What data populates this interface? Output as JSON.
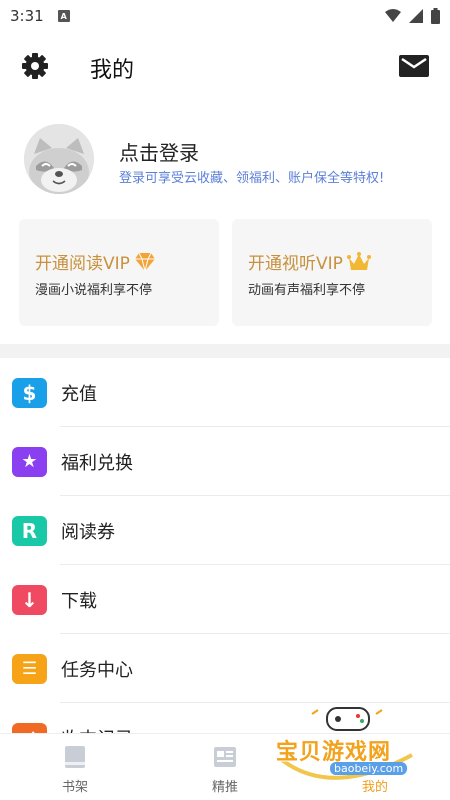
{
  "status_bar": {
    "time": "3:31",
    "app_icon_letter": "A"
  },
  "header": {
    "title": "我的"
  },
  "profile": {
    "login_title": "点击登录",
    "login_subtitle": "登录可享受云收藏、领福利、账户保全等特权!"
  },
  "vip": {
    "read": {
      "title": "开通阅读VIP",
      "subtitle": "漫画小说福利享不停",
      "icon": "diamond-icon",
      "color": "#f2a33a"
    },
    "listen": {
      "title": "开通视听VIP",
      "subtitle": "动画有声福利享不停",
      "icon": "crown-icon",
      "color": "#f2b733"
    }
  },
  "menu": [
    {
      "label": "充值",
      "icon": "dollar-icon",
      "glyph": "$",
      "color": "#1aa0e8"
    },
    {
      "label": "福利兑换",
      "icon": "star-ticket-icon",
      "glyph": "★",
      "color": "#8a3ff0"
    },
    {
      "label": "阅读券",
      "icon": "r-ticket-icon",
      "glyph": "R",
      "color": "#19c8a6"
    },
    {
      "label": "下载",
      "icon": "download-icon",
      "glyph": "↓",
      "color": "#f04a63"
    },
    {
      "label": "任务中心",
      "icon": "task-list-icon",
      "glyph": "☰",
      "color": "#f7a318"
    },
    {
      "label": "收支记录",
      "icon": "record-icon",
      "glyph": "⇄",
      "color": "#f06a26"
    }
  ],
  "bottom_nav": [
    {
      "label": "书架",
      "icon": "bookshelf-icon"
    },
    {
      "label": "精推",
      "icon": "recommend-icon"
    },
    {
      "label": "我的",
      "icon": "profile-icon"
    }
  ],
  "watermark": {
    "text": "宝贝游戏网",
    "url": "baobeiy.com"
  }
}
